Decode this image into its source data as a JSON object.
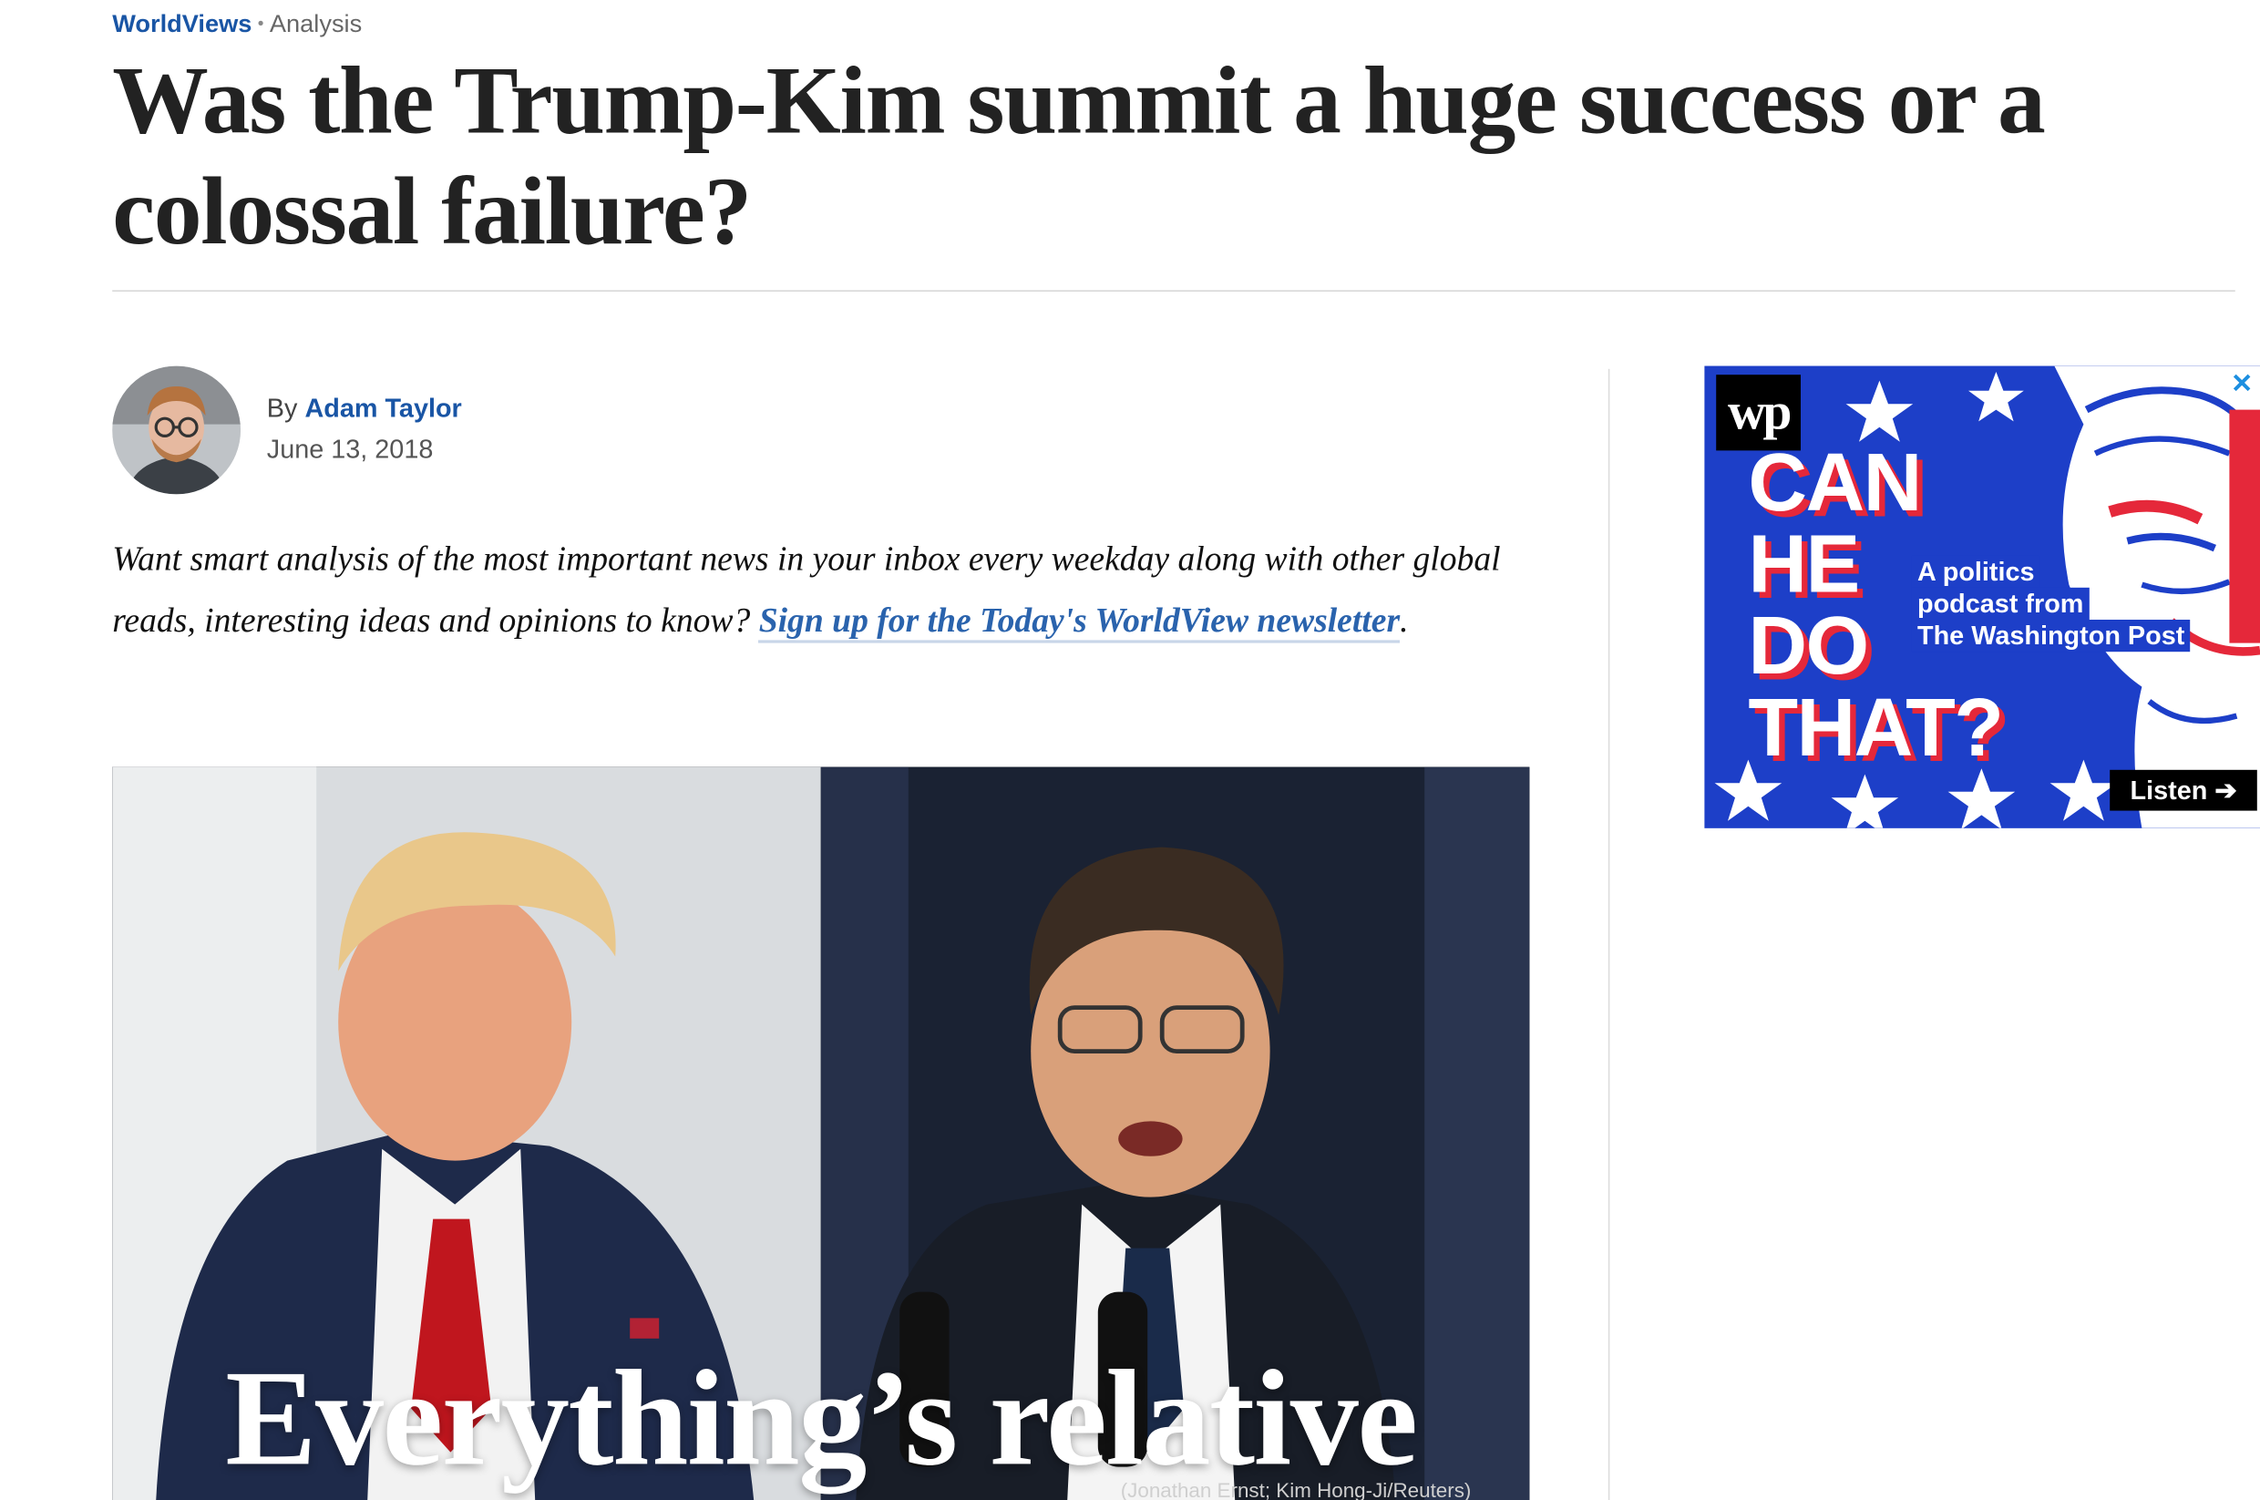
{
  "article": {
    "section": "WorldViews",
    "label": "Analysis",
    "headline": "Was the Trump-Kim summit a huge success or a colossal failure?",
    "byline_prefix": "By",
    "author": "Adam Taylor",
    "date": "June 13, 2018",
    "promo_text": "Want smart analysis of the most important news in your inbox every weekday along with other global reads, interesting ideas and opinions to know? ",
    "promo_link": "Sign up for the Today's WorldView newsletter",
    "promo_end": "."
  },
  "hero": {
    "overlay_text": "Everything’s relative",
    "credit": "(Jonathan Ernst; Kim Hong-Ji/Reuters)"
  },
  "ad": {
    "logo": "wp",
    "title_lines": [
      "CAN",
      "HE",
      "DO",
      "THAT?"
    ],
    "tagline_lines": [
      "A politics",
      "podcast from",
      "The Washington Post"
    ],
    "cta": "Listen ➔",
    "close": "✕"
  },
  "colors": {
    "link_blue": "#1955a5",
    "ad_blue": "#1d3fc8",
    "ad_red": "#e5283a"
  }
}
